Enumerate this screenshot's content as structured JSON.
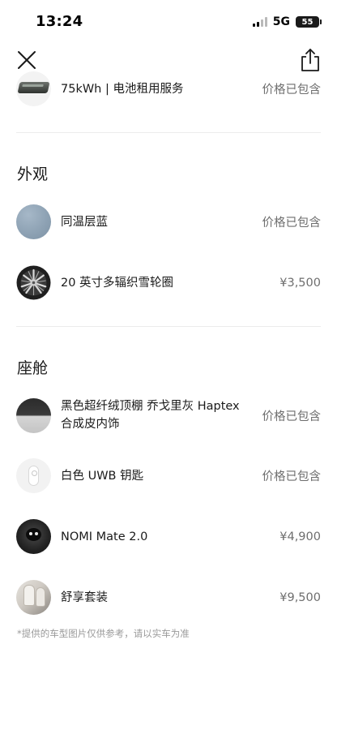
{
  "status_bar": {
    "time": "13:24",
    "network": "5G",
    "battery": "55"
  },
  "icons": {
    "close": "close-icon",
    "share": "share-icon"
  },
  "battery_option": {
    "name": "75kWh | 电池租用服务",
    "price": "价格已包含"
  },
  "exterior": {
    "title": "外观",
    "items": [
      {
        "name": "同温层蓝",
        "price": "价格已包含",
        "swatch_color": "#8fa3b5"
      },
      {
        "name": "20 英寸多辐织雪轮圈",
        "price": "¥3,500"
      }
    ]
  },
  "cabin": {
    "title": "座舱",
    "items": [
      {
        "name": "黑色超纤绒顶棚 乔戈里灰 Haptex合成皮内饰",
        "price": "价格已包含"
      },
      {
        "name": "白色 UWB 钥匙",
        "price": "价格已包含"
      },
      {
        "name": "NOMI Mate 2.0",
        "price": "¥4,900"
      },
      {
        "name": "舒享套装",
        "price": "¥9,500"
      }
    ]
  },
  "footnote": "*提供的车型图片仅供参考，请以实车为准",
  "colors": {
    "text_primary": "#1a1a1a",
    "text_secondary": "#6e6e6e",
    "text_note": "#9a9a9a",
    "divider": "#ececec"
  }
}
